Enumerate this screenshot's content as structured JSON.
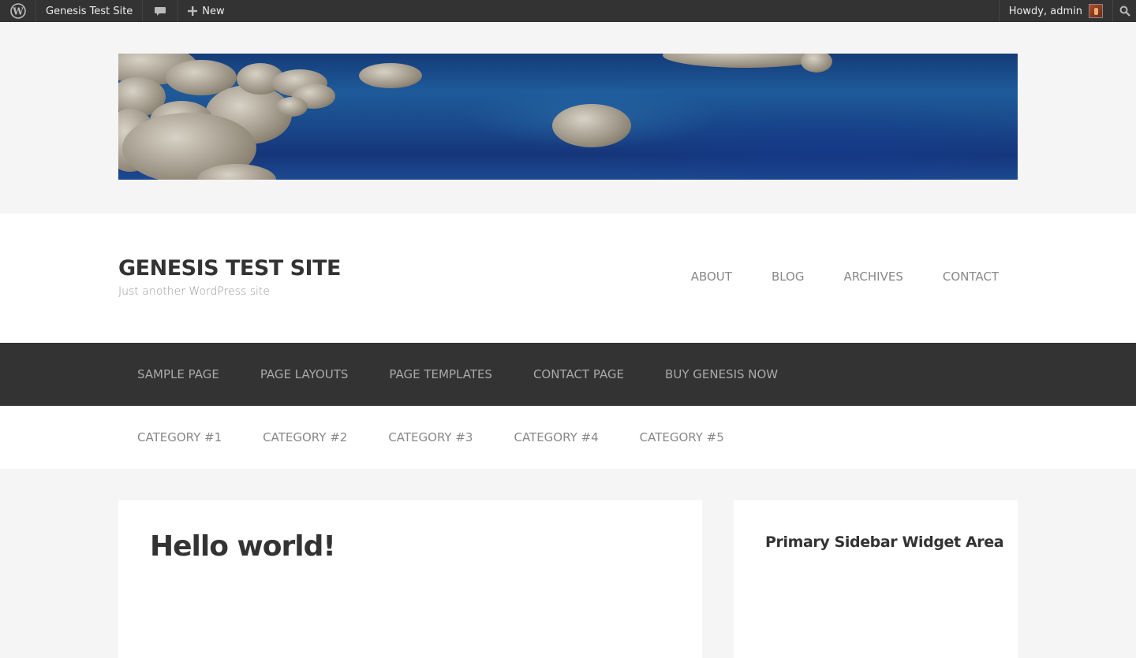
{
  "admin_bar": {
    "site_name": "Genesis Test Site",
    "new_label": "New",
    "howdy": "Howdy, admin",
    "icons": [
      "wordpress-logo-icon",
      "comment-bubble-icon",
      "plus-icon",
      "avatar",
      "search-icon"
    ]
  },
  "header": {
    "title": "GENESIS TEST SITE",
    "description": "Just another WordPress site",
    "nav": [
      "ABOUT",
      "BLOG",
      "ARCHIVES",
      "CONTACT"
    ]
  },
  "primary_nav": [
    "SAMPLE PAGE",
    "PAGE LAYOUTS",
    "PAGE TEMPLATES",
    "CONTACT PAGE",
    "BUY GENESIS NOW"
  ],
  "secondary_nav": [
    "CATEGORY #1",
    "CATEGORY #2",
    "CATEGORY #3",
    "CATEGORY #4",
    "CATEGORY #5"
  ],
  "content": {
    "entry_title": "Hello world!"
  },
  "sidebar": {
    "widget_title": "Primary Sidebar Widget Area"
  },
  "colors": {
    "admin_bar_bg": "#333333",
    "page_bg": "#f5f5f5",
    "primary_nav_bg": "#333333"
  }
}
